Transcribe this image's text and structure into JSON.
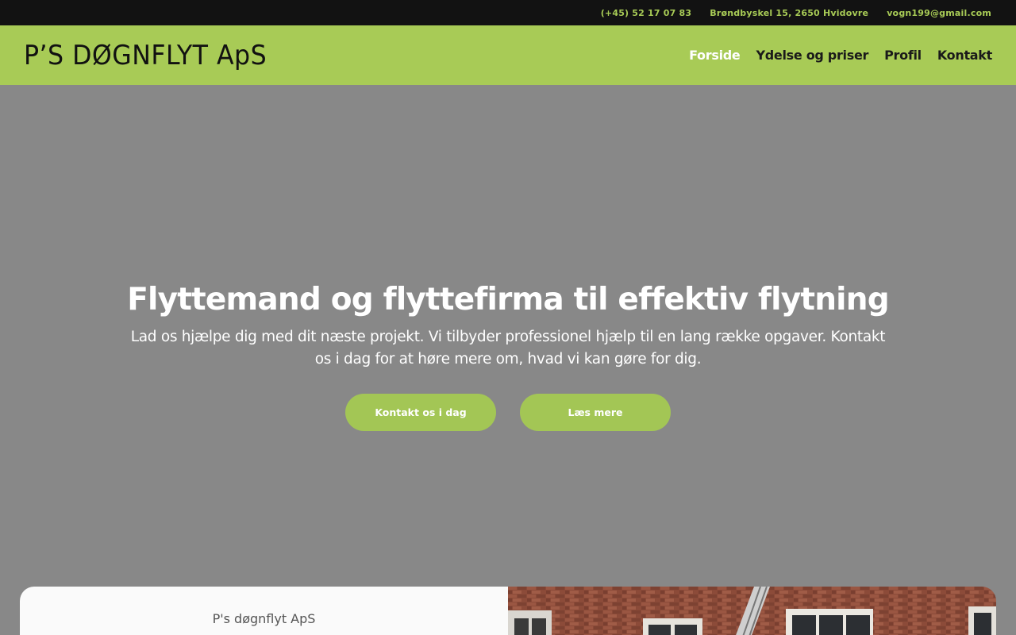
{
  "topbar": {
    "phone": "(+45) 52 17 07 83",
    "address": "Brøndbyskel 15, 2650 Hvidovre",
    "email": "vogn199@gmail.com"
  },
  "header": {
    "logo": "P’S DØGNFLYT ApS",
    "nav": [
      "Forside",
      "Ydelse og priser",
      "Profil",
      "Kontakt"
    ],
    "active_nav": "Forside"
  },
  "hero": {
    "title": "Flyttemand og flyttefirma til effektiv flytning",
    "subtitle": "Lad os hjælpe dig med dit næste projekt. Vi tilbyder professionel hjælp til en lang række opgaver. Kontakt os i dag for at høre mere om, hvad vi kan gøre for dig.",
    "button_contact": "Kontakt os i dag",
    "button_more": "Læs mere"
  },
  "card": {
    "label": "P's døgnflyt ApS"
  },
  "colors": {
    "accent": "#a8cb56",
    "topbar_bg": "#121212",
    "hero_bg": "#888888"
  }
}
